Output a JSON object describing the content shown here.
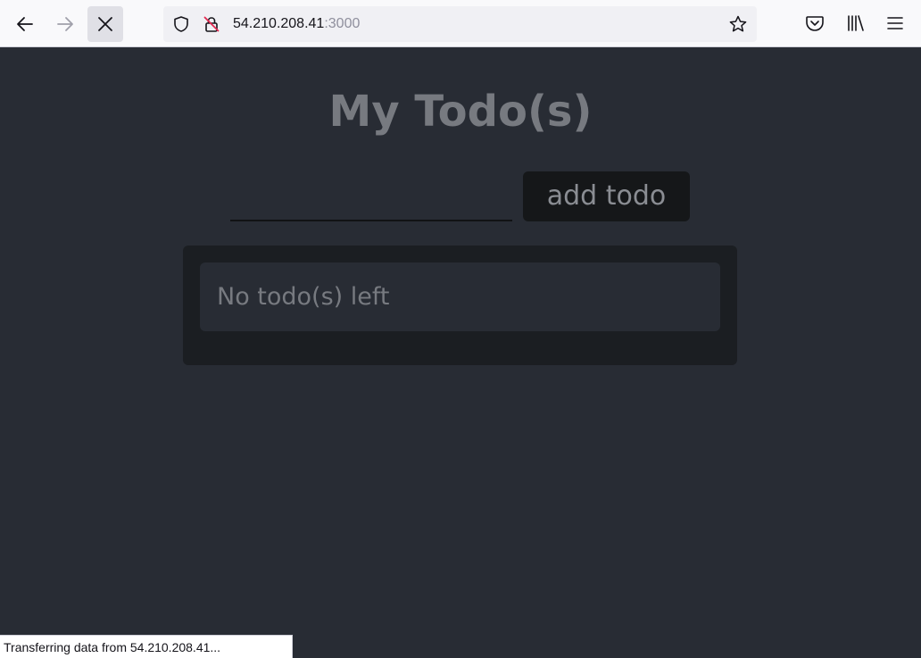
{
  "browser": {
    "url_host": "54.210.208.41",
    "url_port": ":3000",
    "icons": {
      "back": "back-arrow-icon",
      "forward": "forward-arrow-icon",
      "stop": "close-icon",
      "shield": "shield-icon",
      "lock": "insecure-lock-icon",
      "bookmark": "star-icon",
      "pocket": "pocket-icon",
      "library": "library-icon",
      "menu": "hamburger-menu-icon"
    },
    "status_text": "Transferring data from 54.210.208.41..."
  },
  "app": {
    "title": "My Todo(s)",
    "input": {
      "value": "",
      "placeholder": ""
    },
    "add_button_label": "add todo",
    "empty_message": "No todo(s) left"
  },
  "colors": {
    "page_background": "#282c34",
    "panel_background": "#1b1e22",
    "button_background": "#151719",
    "text_muted": "#777a80"
  }
}
